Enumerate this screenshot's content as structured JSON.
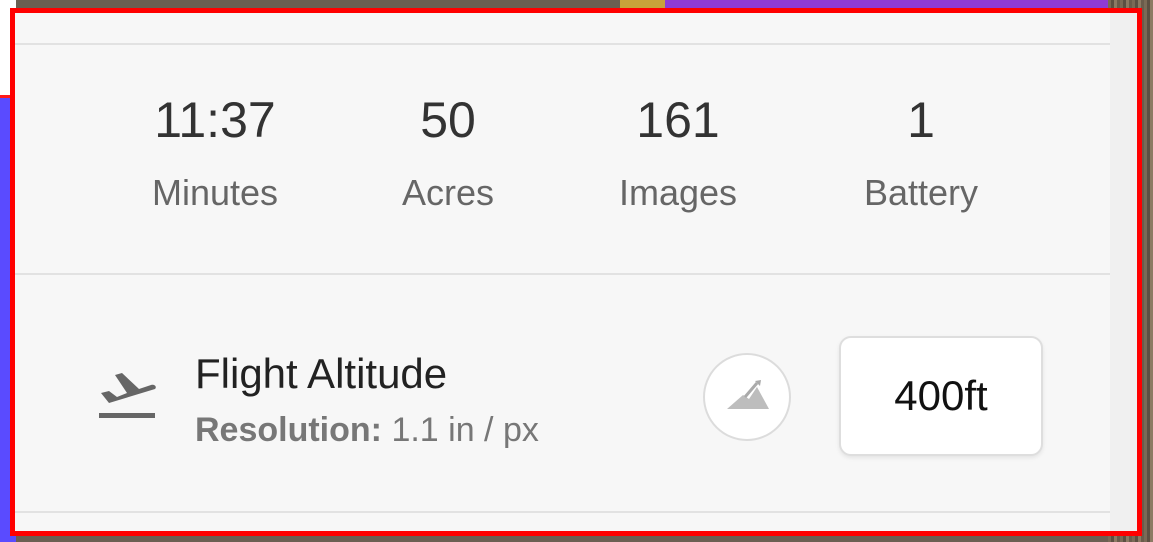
{
  "stats": [
    {
      "value": "11:37",
      "label": "Minutes"
    },
    {
      "value": "50",
      "label": "Acres"
    },
    {
      "value": "161",
      "label": "Images"
    },
    {
      "value": "1",
      "label": "Battery"
    }
  ],
  "altitude": {
    "icon": "takeoff-plane-icon",
    "title": "Flight Altitude",
    "resolution_label": "Resolution:",
    "resolution_value": "1.1 in / px",
    "terrain_icon": "terrain-mountain-icon",
    "value": "400ft"
  },
  "colors": {
    "frame_border": "#ff0000",
    "panel_bg": "#f7f7f7",
    "text_primary": "#333333",
    "text_secondary": "#666666"
  }
}
